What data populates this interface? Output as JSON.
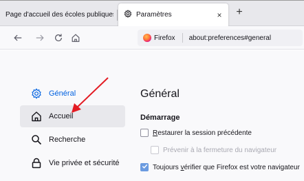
{
  "tabs": [
    {
      "title": "Page d'accueil des écoles publiques ×",
      "active": false
    },
    {
      "title": "Paramètres",
      "active": true,
      "close": "×"
    }
  ],
  "newtab_label": "+",
  "urlbar": {
    "identity": "Firefox",
    "url": "about:preferences#general"
  },
  "sidebar": {
    "items": [
      {
        "label": "Général",
        "icon": "gear-icon",
        "selected": true
      },
      {
        "label": "Accueil",
        "icon": "home-icon",
        "hovered": true
      },
      {
        "label": "Recherche",
        "icon": "search-icon"
      },
      {
        "label": "Vie privée et sécurité",
        "icon": "lock-icon"
      }
    ]
  },
  "main": {
    "heading": "Général",
    "section": "Démarrage",
    "options": [
      {
        "pre": "",
        "u": "R",
        "post": "estaurer la session précédente",
        "checked": false,
        "disabled": false
      },
      {
        "pre": "",
        "u": "",
        "post": "Prévenir à la fermeture du navigateur",
        "checked": false,
        "disabled": true
      },
      {
        "pre": "Toujours ",
        "u": "v",
        "post": "érifier que Firefox est votre navigateur",
        "checked": true,
        "disabled": false
      }
    ]
  },
  "colors": {
    "accent": "#0061e0",
    "annotation": "#e31b23",
    "checked": "#6b9be0"
  }
}
